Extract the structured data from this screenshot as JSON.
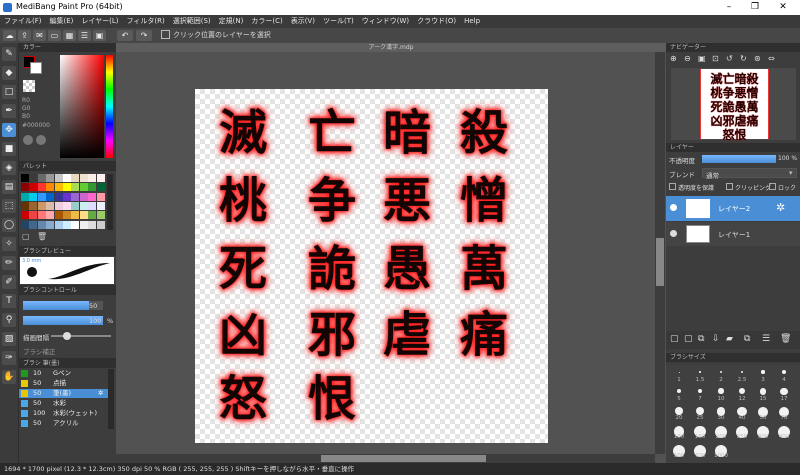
{
  "window": {
    "title": "MediBang Paint Pro (64bit)"
  },
  "menu": [
    "ファイル(F)",
    "編集(E)",
    "レイヤー(L)",
    "フィルタ(R)",
    "選択範囲(S)",
    "定規(N)",
    "カラー(C)",
    "表示(V)",
    "ツール(T)",
    "ウィンドウ(W)",
    "クラウド(O)",
    "Help"
  ],
  "toolbar": {
    "checkbox_label": "クリック位置のレイヤーを選択"
  },
  "color_panel": {
    "title": "カラー",
    "r": "R0",
    "g": "G0",
    "b": "B0",
    "hex": "#000000"
  },
  "palette_panel": {
    "title": "パレット"
  },
  "brush_preview": {
    "title": "ブラシプレビュー",
    "size": "3.0 mm"
  },
  "brush_control": {
    "title": "ブラシコントロール",
    "size_value": "50",
    "opacity_value": "100",
    "opacity_unit": "%",
    "spacing_label": "描画間隔",
    "extra_label": "ブラシ補正"
  },
  "brush_list": {
    "title": "ブラシ 筆(墨)",
    "items": [
      {
        "size": "10",
        "name": "Gペン"
      },
      {
        "size": "50",
        "name": "点描"
      },
      {
        "size": "50",
        "name": "筆(墨)"
      },
      {
        "size": "50",
        "name": "水彩"
      },
      {
        "size": "100",
        "name": "水彩(ウェット)"
      },
      {
        "size": "50",
        "name": "アクリル"
      }
    ]
  },
  "canvas": {
    "tab": "アーク漢字.mdp",
    "kanji": [
      "滅",
      "亡",
      "暗",
      "殺",
      "桃",
      "争",
      "悪",
      "憎",
      "死",
      "詭",
      "愚",
      "萬",
      "凶",
      "邪",
      "虐",
      "痛",
      "怒",
      "恨"
    ]
  },
  "navigator": {
    "title": "ナビゲーター"
  },
  "layers": {
    "title": "レイヤー",
    "opacity_label": "不透明度",
    "opacity_value": "100 %",
    "blend_label": "ブレンド",
    "blend_value": "通常",
    "protect_label": "透明度を保護",
    "clipping_label": "クリッピング",
    "lock_label": "ロック",
    "items": [
      {
        "name": "レイヤー2",
        "selected": true
      },
      {
        "name": "レイヤー1",
        "selected": false
      }
    ]
  },
  "brush_size": {
    "title": "ブラシサイズ",
    "labels": [
      "1",
      "1.5",
      "2",
      "2.5",
      "3",
      "4",
      "5",
      "7",
      "10",
      "12",
      "15",
      "17",
      "20",
      "25",
      "30",
      "40",
      "50",
      "70",
      "100",
      "150",
      "200",
      "250",
      "300",
      "400",
      "500",
      "700",
      "1000"
    ]
  },
  "status": {
    "text": "1694 * 1700 pixel  (12.3 * 12.3cm)  350 dpi  50 %  RGB ( 255, 255, 255 )  Shiftキーを押しながら水平・垂直に操作"
  },
  "colors": {
    "accent": "#4a8fd6",
    "selected_layer": "#4a8fd6",
    "glow": "#ff2a2a"
  }
}
